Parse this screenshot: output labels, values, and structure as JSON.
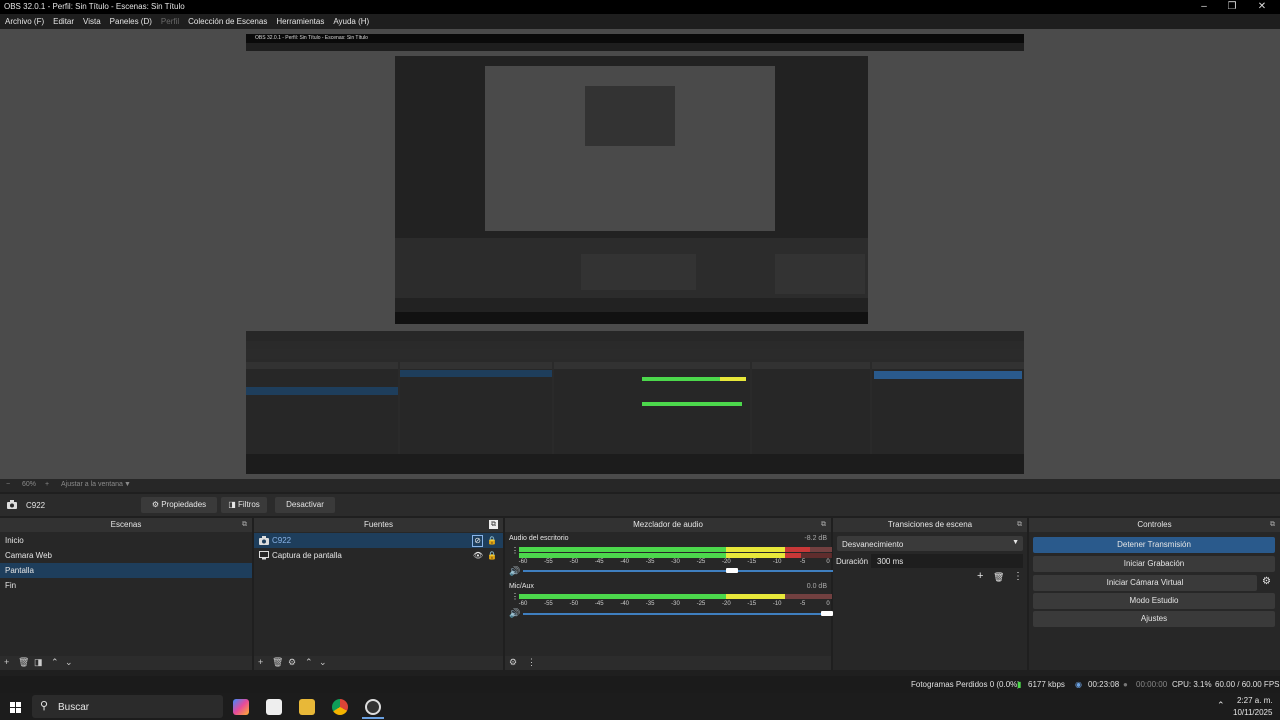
{
  "window": {
    "title": "OBS 32.0.1 - Perfil: Sin Título - Escenas: Sin Título"
  },
  "menu": [
    {
      "label": "Archivo (F)",
      "disabled": false
    },
    {
      "label": "Editar",
      "disabled": false
    },
    {
      "label": "Vista",
      "disabled": false
    },
    {
      "label": "Paneles (D)",
      "disabled": false
    },
    {
      "label": "Perfil",
      "disabled": true
    },
    {
      "label": "Colección de Escenas",
      "disabled": false
    },
    {
      "label": "Herramientas",
      "disabled": false
    },
    {
      "label": "Ayuda (H)",
      "disabled": false
    }
  ],
  "preview": {
    "nested_title": "OBS 32.0.1 - Perfil: Sin Título - Escenas: Sin Título"
  },
  "zoombar": {
    "minus": "−",
    "zoom": "60%",
    "plus": "+",
    "fit": "Ajustar a la ventana"
  },
  "context": {
    "source_name": "C922",
    "properties": "Propiedades",
    "filters": "Filtros",
    "deactivate": "Desactivar"
  },
  "scenes": {
    "title": "Escenas",
    "items": [
      "Inicio",
      "Camara Web",
      "Pantalla",
      "Fin"
    ],
    "selected": 2
  },
  "sources": {
    "title": "Fuentes",
    "items": [
      {
        "name": "C922",
        "icon": "camera-icon"
      },
      {
        "name": "Captura de pantalla",
        "icon": "monitor-icon"
      }
    ]
  },
  "mixer": {
    "title": "Mezclador de audio",
    "channels": [
      {
        "name": "Audio del escritorio",
        "db": "-8.2 dB",
        "level": 0.93,
        "volume": 0.68
      },
      {
        "name": "Mic/Aux",
        "db": "0.0 dB",
        "level": 0.85,
        "volume": 1.0
      }
    ],
    "ticks": [
      "-60",
      "-55",
      "-50",
      "-45",
      "-40",
      "-35",
      "-30",
      "-25",
      "-20",
      "-15",
      "-10",
      "-5",
      "0"
    ]
  },
  "transitions": {
    "title": "Transiciones de escena",
    "selected": "Desvanecimiento",
    "duration_label": "Duración",
    "duration_value": "300 ms"
  },
  "controls": {
    "title": "Controles",
    "stop_stream": "Detener Transmisión",
    "start_record": "Iniciar Grabación",
    "start_vcam": "Iniciar Cámara Virtual",
    "studio": "Modo Estudio",
    "settings": "Ajustes"
  },
  "status": {
    "dropped": "Fotogramas Perdidos 0 (0.0%)",
    "bitrate": "6177 kbps",
    "stream_time": "00:23:08",
    "rec_time": "00:00:00",
    "cpu": "CPU: 3.1%",
    "fps": "60.00 / 60.00 FPS"
  },
  "taskbar": {
    "search": "Buscar",
    "time": "2:27 a. m.",
    "date": "10/11/2025"
  },
  "colors": {
    "accent": "#2a5a8c",
    "selected": "#1e3e5c",
    "meter_green": "#4cd84c",
    "meter_yellow": "#e8e83a",
    "meter_red": "#c83838"
  }
}
